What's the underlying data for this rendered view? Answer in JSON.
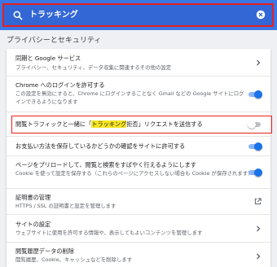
{
  "search": {
    "value": "トラッキング",
    "icon": "search-icon",
    "clear_icon": "clear-icon"
  },
  "section_title": "プライバシーとセキュリティ",
  "colors": {
    "header": "#3b78e7",
    "search_box": "#3367d6",
    "highlight_border": "#e8201f",
    "highlight_text": "#f6e626",
    "toggle_on": "#1a73e8"
  },
  "rows": {
    "sync": {
      "title": "同期と Google サービス",
      "sub": "プライバシー、セキュリティ、データ収集に関連するその他の設定"
    },
    "signin": {
      "title": "Chrome へのログインを許可する",
      "sub1": "この設定を無効にすると、Chrome にログインすることなく Gmail などの Google サイトにログ",
      "sub2": "インできるようになります",
      "enabled": true
    },
    "dnt": {
      "title_before": "閲覧トラフィックと一緒に「",
      "title_highlight": "トラッキング",
      "title_after": "拒否」リクエストを送信する",
      "enabled": false
    },
    "payment": {
      "title": "お支払い方法を保存しているかどうかの確認をサイトに許可する",
      "enabled": true
    },
    "preload": {
      "title": "ページをプリロードして、閲覧と検索をすばやく行えるようにします",
      "sub": "Cookie を使って設定を保存する（これらのページにアクセスしない場合も Cookie が保存されます）",
      "enabled": true
    },
    "certs": {
      "title": "証明書の管理",
      "sub": "HTTPS / SSL の証明書と設定を管理します"
    },
    "site": {
      "title": "サイトの設定",
      "sub": "ウェブサイトに使用を許可する情報や、表示してもよいコンテンツを管理します"
    },
    "clear": {
      "title": "閲覧履歴データの削除",
      "sub": "閲覧履歴、Cookie、キャッシュなどを削除します"
    }
  }
}
